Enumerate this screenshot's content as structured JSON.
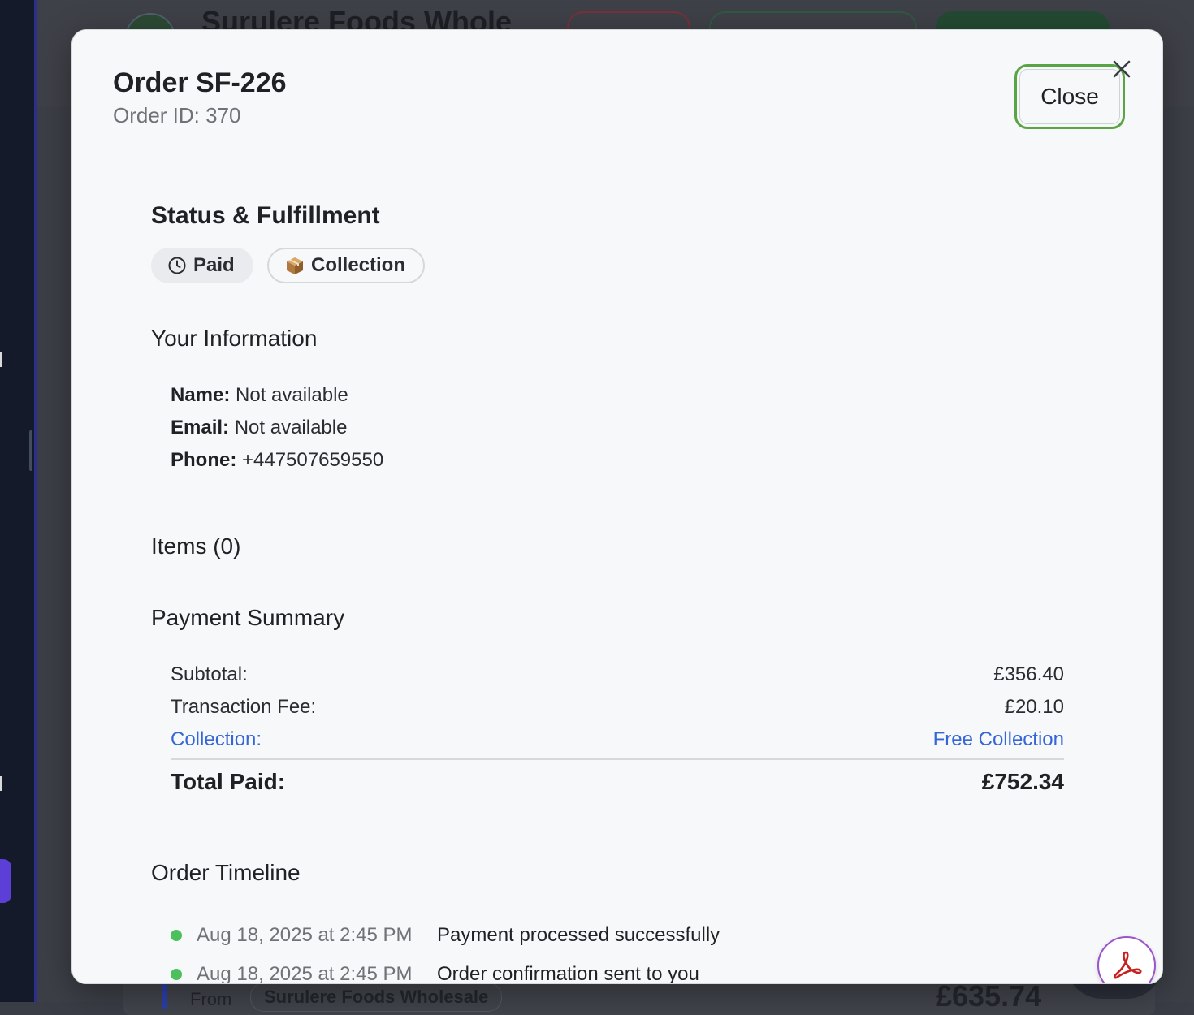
{
  "background": {
    "store_title": "Surulere Foods Whole",
    "order_from_label": "From",
    "order_from_store": "Surulere Foods Wholesale",
    "order_amount": "£635.74"
  },
  "modal": {
    "title": "Order SF-226",
    "order_id": "Order ID: 370",
    "close_label": "Close",
    "status_section": {
      "title": "Status & Fulfillment",
      "payment_status": "Paid",
      "fulfillment_type": "Collection",
      "icons": [
        "clock-icon",
        "package-icon"
      ]
    },
    "info_section": {
      "title": "Your Information",
      "name_label": "Name:",
      "name_value": "Not available",
      "email_label": "Email:",
      "email_value": "Not available",
      "phone_label": "Phone:",
      "phone_value": "+447507659550"
    },
    "items_section": {
      "title": "Items (0)"
    },
    "payment_section": {
      "title": "Payment Summary",
      "subtotal_label": "Subtotal:",
      "subtotal_value": "£356.40",
      "fee_label": "Transaction Fee:",
      "fee_value": "£20.10",
      "collection_label": "Collection:",
      "collection_value": "Free Collection",
      "total_label": "Total Paid:",
      "total_value": "£752.34",
      "accent_color": "#3566d8"
    },
    "timeline_section": {
      "title": "Order Timeline",
      "events": [
        {
          "date": "Aug 18, 2025 at 2:45 PM",
          "text": "Payment processed successfully"
        },
        {
          "date": "Aug 18, 2025 at 2:45 PM",
          "text": "Order confirmation sent to you"
        }
      ],
      "dot_color": "#4cc05c"
    },
    "pdf_button_icon": "pdf-icon"
  }
}
